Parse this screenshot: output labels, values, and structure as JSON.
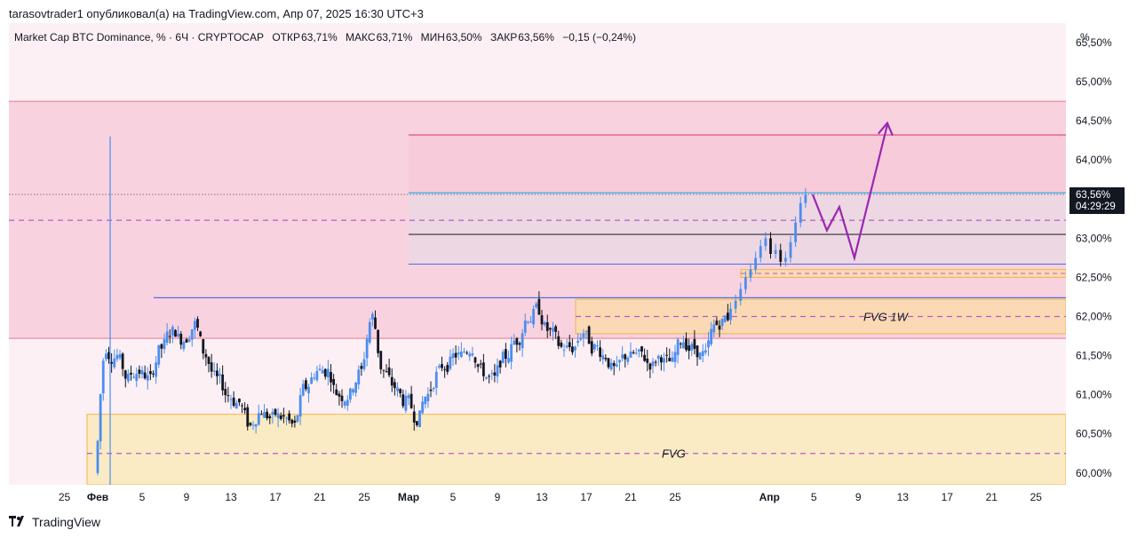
{
  "header": {
    "publisher_line": "tarasovtrader1 опубликовал(а) на TradingView.com, Апр 07, 2025 16:30 UTC+3"
  },
  "legend": {
    "symbol": "Market Cap BTC Dominance, % · 6Ч · CRYPTOCAP",
    "open_label": "ОТКР",
    "open": "63,71%",
    "high_label": "МАКС",
    "high": "63,71%",
    "low_label": "МИН",
    "low": "63,50%",
    "close_label": "ЗАКР",
    "close": "63,56%",
    "change": "−0,15 (−0,24%)"
  },
  "price_badge": {
    "value": "63,56%",
    "countdown": "04:29:29"
  },
  "footer": {
    "brand": "TradingView"
  },
  "colors": {
    "up": "#4a8ef0",
    "down": "#131722",
    "pink_zone": "#f8d3df",
    "pink_line": "#e8798f",
    "fvg_fill": "#fbebc4",
    "fvg_border": "#f0b54a",
    "fvg1w_fill": "#fcd9b5",
    "projection": "#9c27b0",
    "blue_line": "#4f6fe0",
    "dashed": "#b45cc9"
  },
  "chart_data": {
    "type": "candlestick",
    "y_unit": "%",
    "ylim": [
      59.85,
      65.75
    ],
    "y_ticks": [
      "60,00%",
      "60,50%",
      "61,00%",
      "61,50%",
      "62,00%",
      "62,50%",
      "63,00%",
      "63,50%",
      "64,00%",
      "64,50%",
      "65,00%",
      "65,50%"
    ],
    "y_tick_values": [
      60.0,
      60.5,
      61.0,
      61.5,
      62.0,
      62.5,
      63.0,
      63.5,
      64.0,
      64.5,
      65.0,
      65.5
    ],
    "x_range_day": [
      -0.5,
      56.5
    ],
    "x_ticks": [
      {
        "label": "25",
        "day": -3
      },
      {
        "label": "Фев",
        "day": 0
      },
      {
        "label": "5",
        "day": 4
      },
      {
        "label": "9",
        "day": 8
      },
      {
        "label": "13",
        "day": 12
      },
      {
        "label": "17",
        "day": 16
      },
      {
        "label": "21",
        "day": 20
      },
      {
        "label": "25",
        "day": 24
      },
      {
        "label": "Мар",
        "day": 28
      },
      {
        "label": "5",
        "day": 32
      },
      {
        "label": "9",
        "day": 36
      },
      {
        "label": "13",
        "day": 40
      },
      {
        "label": "17",
        "day": 44
      },
      {
        "label": "21",
        "day": 48
      },
      {
        "label": "25",
        "day": 52
      },
      {
        "label": "Апр",
        "day": 60.5
      },
      {
        "label": "5",
        "day": 64.5
      },
      {
        "label": "9",
        "day": 68.5
      },
      {
        "label": "13",
        "day": 72.5
      },
      {
        "label": "17",
        "day": 76.5
      },
      {
        "label": "21",
        "day": 80.5
      },
      {
        "label": "25",
        "day": 84.5
      }
    ],
    "daily_closes": [
      {
        "day": 0,
        "close": 61.6
      },
      {
        "day": 1,
        "close": 61.5
      },
      {
        "day": 2,
        "close": 61.2
      },
      {
        "day": 3,
        "close": 61.3
      },
      {
        "day": 4,
        "close": 61.2
      },
      {
        "day": 5,
        "close": 61.6
      },
      {
        "day": 6,
        "close": 61.8
      },
      {
        "day": 7,
        "close": 61.7
      },
      {
        "day": 8,
        "close": 61.9
      },
      {
        "day": 9,
        "close": 61.5
      },
      {
        "day": 10,
        "close": 61.2
      },
      {
        "day": 11,
        "close": 61.0
      },
      {
        "day": 12,
        "close": 60.9
      },
      {
        "day": 13,
        "close": 60.6
      },
      {
        "day": 14,
        "close": 60.8
      },
      {
        "day": 15,
        "close": 60.7
      },
      {
        "day": 16,
        "close": 60.7
      },
      {
        "day": 17,
        "close": 60.6
      },
      {
        "day": 18,
        "close": 61.1
      },
      {
        "day": 19,
        "close": 61.3
      },
      {
        "day": 20,
        "close": 61.3
      },
      {
        "day": 21,
        "close": 61.0
      },
      {
        "day": 22,
        "close": 61.0
      },
      {
        "day": 23,
        "close": 61.3
      },
      {
        "day": 24,
        "close": 62.0
      },
      {
        "day": 25,
        "close": 61.3
      },
      {
        "day": 26,
        "close": 61.1
      },
      {
        "day": 27,
        "close": 60.9
      },
      {
        "day": 28,
        "close": 60.7
      },
      {
        "day": 29,
        "close": 61.0
      },
      {
        "day": 30,
        "close": 61.3
      },
      {
        "day": 31,
        "close": 61.4
      },
      {
        "day": 32,
        "close": 61.5
      },
      {
        "day": 33,
        "close": 61.6
      },
      {
        "day": 34,
        "close": 61.3
      },
      {
        "day": 35,
        "close": 61.2
      },
      {
        "day": 36,
        "close": 61.5
      },
      {
        "day": 37,
        "close": 61.7
      },
      {
        "day": 38,
        "close": 62.0
      },
      {
        "day": 39,
        "close": 62.1
      },
      {
        "day": 40,
        "close": 61.8
      },
      {
        "day": 41,
        "close": 61.6
      },
      {
        "day": 42,
        "close": 61.6
      },
      {
        "day": 43,
        "close": 61.8
      },
      {
        "day": 44,
        "close": 61.6
      },
      {
        "day": 45,
        "close": 61.5
      },
      {
        "day": 46,
        "close": 61.3
      },
      {
        "day": 47,
        "close": 61.5
      },
      {
        "day": 48,
        "close": 61.5
      },
      {
        "day": 49,
        "close": 61.4
      },
      {
        "day": 50,
        "close": 61.5
      },
      {
        "day": 51,
        "close": 61.4
      },
      {
        "day": 52,
        "close": 61.7
      },
      {
        "day": 53,
        "close": 61.6
      },
      {
        "day": 54,
        "close": 61.5
      },
      {
        "day": 55,
        "close": 61.9
      },
      {
        "day": 56,
        "close": 62.0
      }
    ],
    "annotations": [
      {
        "label": "FVG 1W"
      },
      {
        "label": "FVG"
      }
    ]
  }
}
